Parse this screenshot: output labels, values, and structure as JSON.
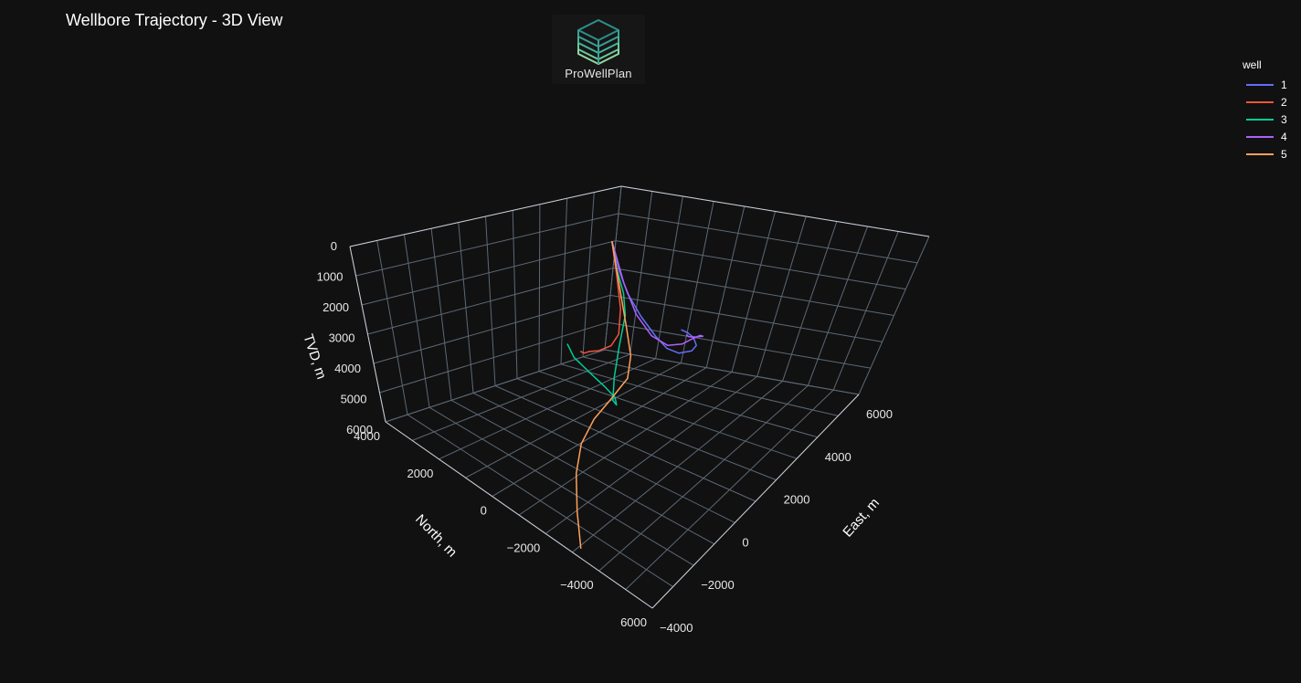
{
  "title": "Wellbore Trajectory - 3D View",
  "logo": {
    "text": "ProWellPlan",
    "icon": "stacked-cube-logo-icon"
  },
  "legend": {
    "title": "well",
    "items": [
      {
        "label": "1",
        "color": "#636efa"
      },
      {
        "label": "2",
        "color": "#ef553b"
      },
      {
        "label": "3",
        "color": "#00cc96"
      },
      {
        "label": "4",
        "color": "#ab63fa"
      },
      {
        "label": "5",
        "color": "#ffa15a"
      }
    ]
  },
  "chart_data": {
    "type": "line3d",
    "title": "Wellbore Trajectory - 3D View",
    "axes": {
      "x": {
        "label": "North, m",
        "ticks": [
          "6000",
          "−4000",
          "−2000",
          "0",
          "2000",
          "4000"
        ],
        "range": [
          -5000,
          5000
        ]
      },
      "y": {
        "label": "East, m",
        "ticks": [
          "−4000",
          "−2000",
          "0",
          "2000",
          "4000",
          "6000"
        ],
        "range": [
          -5000,
          7000
        ]
      },
      "z": {
        "label": "TVD, m",
        "ticks": [
          "0",
          "1000",
          "2000",
          "3000",
          "4000",
          "5000",
          "6000"
        ],
        "range": [
          0,
          6000
        ],
        "reversed": true
      }
    },
    "grid": true,
    "legend_position": "top-right",
    "series": [
      {
        "name": "1",
        "color": "#636efa",
        "points": [
          [
            0,
            0,
            0
          ],
          [
            -50,
            -20,
            800
          ],
          [
            -150,
            -100,
            1500
          ],
          [
            -400,
            -180,
            2200
          ],
          [
            -800,
            -150,
            2900
          ],
          [
            -1200,
            -50,
            3400
          ],
          [
            -1800,
            200,
            3800
          ],
          [
            -2600,
            600,
            4100
          ],
          [
            -3300,
            1200,
            4300
          ],
          [
            -3900,
            2000,
            4400
          ],
          [
            -4400,
            2800,
            4550
          ],
          [
            -4800,
            3500,
            4700
          ]
        ]
      },
      {
        "name": "2",
        "color": "#ef553b",
        "points": [
          [
            0,
            0,
            0
          ],
          [
            20,
            10,
            1000
          ],
          [
            60,
            30,
            1900
          ],
          [
            200,
            120,
            2600
          ],
          [
            400,
            300,
            2900
          ],
          [
            700,
            520,
            3000
          ],
          [
            900,
            700,
            3000
          ],
          [
            1000,
            850,
            3050
          ],
          [
            1050,
            950,
            3000
          ]
        ]
      },
      {
        "name": "3",
        "color": "#00cc96",
        "points": [
          [
            0,
            0,
            0
          ],
          [
            -100,
            200,
            800
          ],
          [
            -300,
            400,
            1600
          ],
          [
            -200,
            300,
            2200
          ],
          [
            500,
            -300,
            2800
          ],
          [
            1200,
            -900,
            3300
          ],
          [
            1600,
            -1200,
            3700
          ],
          [
            1300,
            -800,
            4000
          ],
          [
            800,
            0,
            4150
          ],
          [
            500,
            900,
            4150
          ],
          [
            300,
            1800,
            4050
          ],
          [
            200,
            2700,
            3800
          ],
          [
            100,
            3100,
            3500
          ]
        ]
      },
      {
        "name": "4",
        "color": "#ab63fa",
        "points": [
          [
            0,
            0,
            0
          ],
          [
            -100,
            -80,
            1200
          ],
          [
            -250,
            -200,
            2100
          ],
          [
            -600,
            -250,
            2800
          ],
          [
            -1200,
            -100,
            3300
          ],
          [
            -2000,
            300,
            3600
          ],
          [
            -2800,
            800,
            3800
          ],
          [
            -3500,
            1300,
            4050
          ],
          [
            -4100,
            1800,
            4400
          ],
          [
            -4500,
            2500,
            4700
          ],
          [
            -4900,
            3200,
            4950
          ],
          [
            -5300,
            3700,
            5100
          ]
        ]
      },
      {
        "name": "5",
        "color": "#ffa15a",
        "points": [
          [
            0,
            0,
            0
          ],
          [
            10,
            -20,
            1200
          ],
          [
            20,
            -50,
            2400
          ],
          [
            80,
            -120,
            3200
          ],
          [
            400,
            -250,
            3700
          ],
          [
            1200,
            -350,
            4000
          ],
          [
            2000,
            -500,
            4200
          ],
          [
            2800,
            -700,
            4500
          ],
          [
            3500,
            -1000,
            4900
          ],
          [
            4200,
            -1400,
            5400
          ],
          [
            4800,
            -1700,
            5900
          ]
        ]
      }
    ]
  }
}
